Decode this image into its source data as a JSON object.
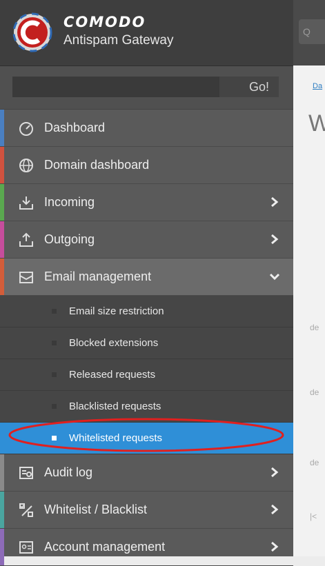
{
  "brand": {
    "name": "COMODO",
    "product": "Antispam Gateway"
  },
  "search": {
    "placeholder": "",
    "go_label": "Go!"
  },
  "nav": {
    "items": [
      {
        "label": "Dashboard",
        "icon": "dashboard-icon",
        "stripe": "#4a7fc1"
      },
      {
        "label": "Domain dashboard",
        "icon": "globe-icon",
        "stripe": "#d0523f"
      },
      {
        "label": "Incoming",
        "icon": "inbox-download-icon",
        "stripe": "#5aa84f"
      },
      {
        "label": "Outgoing",
        "icon": "inbox-upload-icon",
        "stripe": "#c64d9c"
      },
      {
        "label": "Email management",
        "icon": "envelope-tray-icon",
        "stripe": "#d35d3a"
      }
    ],
    "submenu": [
      {
        "label": "Email size restriction"
      },
      {
        "label": "Blocked extensions"
      },
      {
        "label": "Released requests"
      },
      {
        "label": "Blacklisted requests"
      },
      {
        "label": "Whitelisted requests"
      }
    ],
    "bottom_items": [
      {
        "label": "Audit log",
        "icon": "audit-log-icon",
        "stripe": "#8a8a8a"
      },
      {
        "label": "Whitelist / Blacklist",
        "icon": "percent-list-icon",
        "stripe": "#4aa5a0"
      },
      {
        "label": "Account management",
        "icon": "account-card-icon",
        "stripe": "#8d6bb8"
      }
    ]
  },
  "main": {
    "quick_label": "Q",
    "breadcrumb": "Da",
    "title": "W",
    "fragments": [
      "de",
      "de",
      "de",
      "|<"
    ]
  },
  "colors": {
    "sidebar": "#5a5a5a",
    "active_sub": "#2f8fd7",
    "highlight_ring": "#e0201f"
  }
}
